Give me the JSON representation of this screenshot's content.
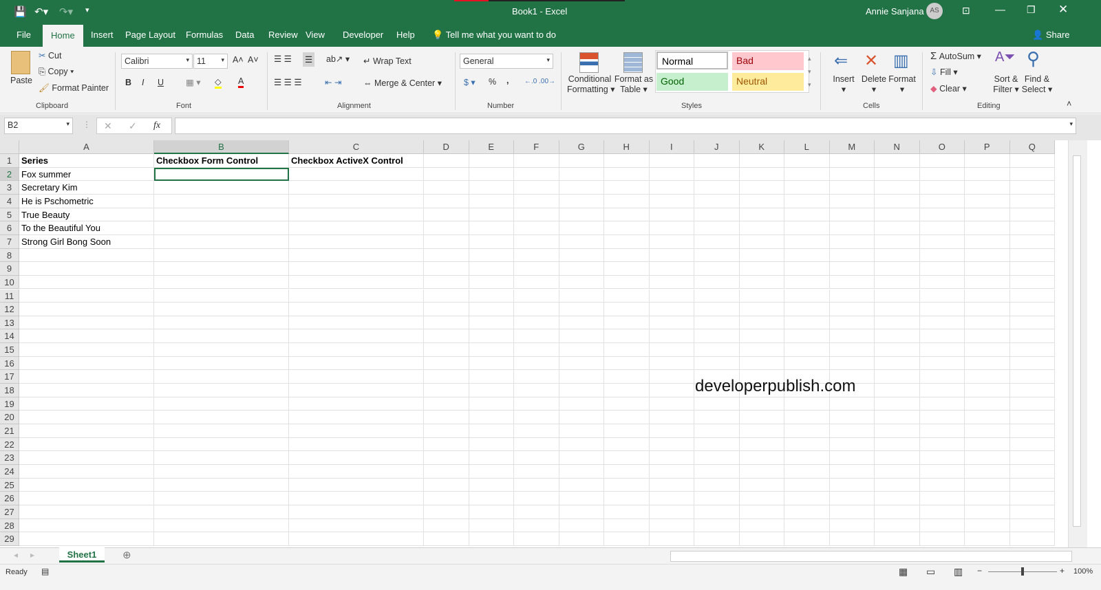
{
  "window": {
    "title": "Book1  -  Excel",
    "user": "Annie Sanjana",
    "avatar": "AS",
    "share": "Share"
  },
  "menu_tabs": [
    "File",
    "Home",
    "Insert",
    "Page Layout",
    "Formulas",
    "Data",
    "Review",
    "View",
    "Developer",
    "Help"
  ],
  "active_tab": "Home",
  "tell_me": "Tell me what you want to do",
  "ribbon": {
    "clipboard": {
      "label": "Clipboard",
      "paste": "Paste",
      "cut": "Cut",
      "copy": "Copy",
      "format_painter": "Format Painter"
    },
    "font": {
      "label": "Font",
      "name": "Calibri",
      "size": "11",
      "bold": "B",
      "italic": "I",
      "underline": "U"
    },
    "alignment": {
      "label": "Alignment",
      "wrap": "Wrap Text",
      "merge": "Merge & Center"
    },
    "number": {
      "label": "Number",
      "format": "General",
      "percent": "%",
      "comma": ","
    },
    "styles": {
      "label": "Styles",
      "conditional": "Conditional",
      "conditional2": "Formatting",
      "format_as": "Format as",
      "format_as2": "Table",
      "normal": "Normal",
      "bad": "Bad",
      "good": "Good",
      "neutral": "Neutral"
    },
    "cells": {
      "label": "Cells",
      "insert": "Insert",
      "delete": "Delete",
      "format": "Format"
    },
    "editing": {
      "label": "Editing",
      "autosum": "AutoSum",
      "fill": "Fill",
      "clear": "Clear",
      "sort": "Sort &",
      "sort2": "Filter",
      "find": "Find &",
      "find2": "Select"
    }
  },
  "formula_bar": {
    "name_box": "B2",
    "fx": "fx",
    "value": ""
  },
  "columns": [
    "A",
    "B",
    "C",
    "D",
    "E",
    "F",
    "G",
    "H",
    "I",
    "J",
    "K",
    "L",
    "M",
    "N",
    "O",
    "P",
    "Q"
  ],
  "row_count": 29,
  "selected_cell": "B2",
  "cells": [
    {
      "ref": "A1",
      "v": "Series",
      "bold": true
    },
    {
      "ref": "B1",
      "v": "Checkbox Form Control",
      "bold": true
    },
    {
      "ref": "C1",
      "v": "Checkbox ActiveX Control",
      "bold": true
    },
    {
      "ref": "A2",
      "v": "Fox summer"
    },
    {
      "ref": "A3",
      "v": "Secretary Kim"
    },
    {
      "ref": "A4",
      "v": "He is Pschometric"
    },
    {
      "ref": "A5",
      "v": "True Beauty"
    },
    {
      "ref": "A6",
      "v": "To the Beautiful You"
    },
    {
      "ref": "A7",
      "v": "Strong Girl Bong Soon"
    }
  ],
  "watermark": "developerpublish.com",
  "sheets": [
    "Sheet1"
  ],
  "status": {
    "text": "Ready",
    "zoom": "100%"
  },
  "colors": {
    "accent": "#217346"
  }
}
